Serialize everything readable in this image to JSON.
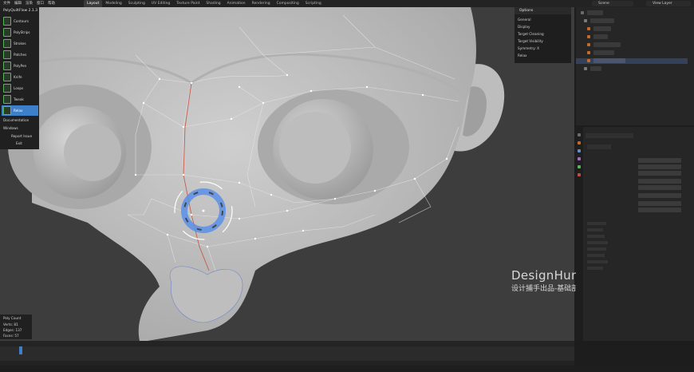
{
  "topbar": {
    "menus": [
      "文件",
      "编辑",
      "渲染",
      "窗口",
      "帮助"
    ],
    "workspaces": [
      "Layout",
      "Modeling",
      "Sculpting",
      "UV Editing",
      "Texture Paint",
      "Shading",
      "Animation",
      "Rendering",
      "Compositing",
      "Scripting"
    ],
    "active_workspace": "Layout",
    "scene": "Scene",
    "view_layer": "View Layer"
  },
  "polyquilt": {
    "title": "PolyQuiltFlow 2.1.3",
    "tools": [
      "Contours",
      "PolyStrips",
      "Strokes",
      "Patches",
      "PolyPen",
      "Knife",
      "Loops",
      "Tweak",
      "Relax"
    ],
    "active_tool": "Relax",
    "extra": [
      "Documentation",
      "Windows",
      "Report Issue",
      "Exit"
    ]
  },
  "options": {
    "title": "Options",
    "items": [
      "General",
      "Display",
      "Target Cleaning",
      "Target Visibility",
      "Symmetry: X",
      "Relax"
    ]
  },
  "keycount": {
    "title": "Poly Count",
    "verts": "Verts:  81",
    "edges": "Edges: 137",
    "faces": "Faces:  57"
  },
  "watermark": {
    "line1": "DesignHunting",
    "line2": "设计捕手出品-基础部分"
  },
  "colors": {
    "mesh": "#c4c4c4",
    "viewport_bg": "#3d3d3d",
    "accent": "#3d7fc9",
    "brush": "#5b8fe6"
  }
}
